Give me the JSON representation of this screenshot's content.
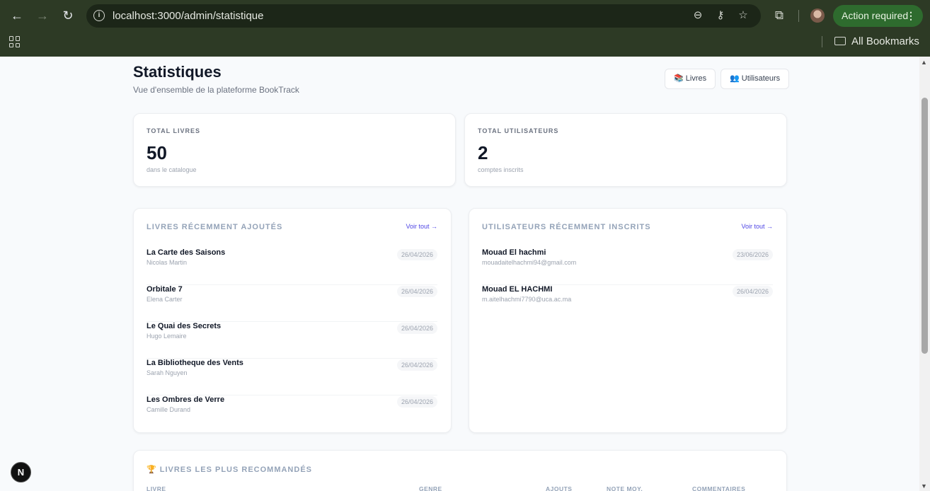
{
  "browser": {
    "back_icon": "←",
    "forward_icon": "→",
    "reload_icon": "↻",
    "url": "localhost:3000/admin/statistique",
    "zoom_icon": "⊖",
    "password_icon": "⚷",
    "bookmark_icon": "☆",
    "extensions_icon": "⧉",
    "action_label": "Action required",
    "action_menu": "⋮",
    "bookmarks_label": "All Bookmarks"
  },
  "header": {
    "title": "Statistiques",
    "subtitle": "Vue d'ensemble de la plateforme BookTrack",
    "livres_button": "📚 Livres",
    "utilisateurs_button": "👥 Utilisateurs"
  },
  "stats": {
    "books": {
      "label": "TOTAL LIVRES",
      "value": "50",
      "sub": "dans le catalogue"
    },
    "users": {
      "label": "TOTAL UTILISATEURS",
      "value": "2",
      "sub": "comptes inscrits"
    }
  },
  "recent_books": {
    "title": "LIVRES RÉCEMMENT AJOUTÉS",
    "link": "Voir tout →",
    "items": [
      {
        "title": "La Carte des Saisons",
        "author": "Nicolas Martin",
        "date": "26/04/2026"
      },
      {
        "title": "Orbitale 7",
        "author": "Elena Carter",
        "date": "26/04/2026"
      },
      {
        "title": "Le Quai des Secrets",
        "author": "Hugo Lemaire",
        "date": "26/04/2026"
      },
      {
        "title": "La Bibliotheque des Vents",
        "author": "Sarah Nguyen",
        "date": "26/04/2026"
      },
      {
        "title": "Les Ombres de Verre",
        "author": "Camille Durand",
        "date": "26/04/2026"
      }
    ]
  },
  "recent_users": {
    "title": "UTILISATEURS RÉCEMMENT INSCRITS",
    "link": "Voir tout →",
    "items": [
      {
        "name": "Mouad El hachmi",
        "email": "mouadaitelhachmi94@gmail.com",
        "date": "23/06/2026"
      },
      {
        "name": "Mouad EL HACHMI",
        "email": "m.aitelhachmi7790@uca.ac.ma",
        "date": "26/04/2026"
      }
    ]
  },
  "recommended": {
    "title": "🏆 LIVRES LES PLUS RECOMMANDÉS",
    "columns": [
      "LIVRE",
      "GENRE",
      "AJOUTS",
      "NOTE MOY.",
      "COMMENTAIRES"
    ]
  },
  "dev_badge": "N",
  "colors": {
    "chrome_bg": "#2d3a25",
    "accent": "#4f46e5",
    "action_green": "#2e6b2e"
  }
}
